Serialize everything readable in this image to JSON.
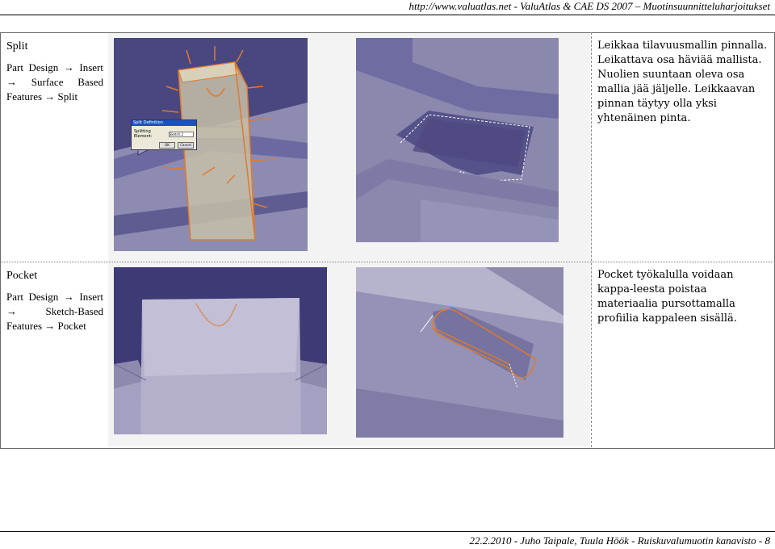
{
  "header": {
    "text": "http://www.valuatlas.net - ValuAtlas & CAE DS 2007 – Muotinsuunnitteluharjoitukset"
  },
  "rows": [
    {
      "title": "Split",
      "path": "Part Design → Insert → Surface Based Features → Split",
      "description": "Leikkaa tilavuusmallin pinnalla. Leikattava osa häviää mallista. Nuolien suuntaan oleva osa mallia jää jäljelle. Leikkaavan pinnan täytyy olla yksi yhtenäinen pinta.",
      "dialog": {
        "title": "Split Definition",
        "field_label": "Splitting Element:",
        "field_value": "Sketch.2",
        "ok": "OK",
        "cancel": "Cancel"
      }
    },
    {
      "title": "Pocket",
      "path": "Part Design → Insert → Sketch-Based Features → Pocket",
      "description": "Pocket työkalulla voidaan kappa-leesta poistaa materiaalia pursottamalla profiilia kappaleen sisällä."
    }
  ],
  "footer": {
    "text": "22.2.2010 - Juho Taipale, Tuula Höök - Ruiskuvalumuotin kanavisto - 8"
  },
  "colors": {
    "model_face": "#8d8aae",
    "model_dark": "#4e4b77",
    "highlight": "#e07a2a",
    "background_blue": "#3d3a75"
  }
}
